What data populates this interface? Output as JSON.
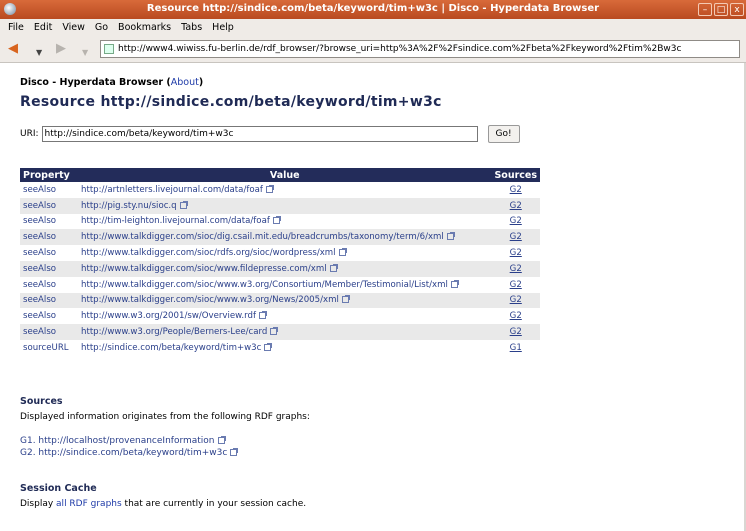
{
  "window": {
    "title": "Resource http://sindice.com/beta/keyword/tim+w3c | Disco - Hyperdata Browser",
    "buttons": [
      "–",
      "□",
      "x"
    ]
  },
  "menu": [
    "File",
    "Edit",
    "View",
    "Go",
    "Bookmarks",
    "Tabs",
    "Help"
  ],
  "nav": {
    "url": "http://www4.wiwiss.fu-berlin.de/rdf_browser/?browse_uri=http%3A%2F%2Fsindice.com%2Fbeta%2Fkeyword%2Ftim%2Bw3c"
  },
  "page": {
    "app_name": "Disco - Hyperdata Browser",
    "about_link": "About",
    "title": "Resource http://sindice.com/beta/keyword/tim+w3c",
    "uri_label": "URI:",
    "uri_value": "http://sindice.com/beta/keyword/tim+w3c",
    "go_label": "Go!",
    "table": {
      "headers": [
        "Property",
        "Value",
        "Sources"
      ],
      "rows": [
        {
          "property": "seeAlso",
          "value": "http://artnletters.livejournal.com/data/foaf",
          "source": "G2"
        },
        {
          "property": "seeAlso",
          "value": "http://pig.sty.nu/sioc.q",
          "source": "G2"
        },
        {
          "property": "seeAlso",
          "value": "http://tim-leighton.livejournal.com/data/foaf",
          "source": "G2"
        },
        {
          "property": "seeAlso",
          "value": "http://www.talkdigger.com/sioc/dig.csail.mit.edu/breadcrumbs/taxonomy/term/6/xml",
          "source": "G2"
        },
        {
          "property": "seeAlso",
          "value": "http://www.talkdigger.com/sioc/rdfs.org/sioc/wordpress/xml",
          "source": "G2"
        },
        {
          "property": "seeAlso",
          "value": "http://www.talkdigger.com/sioc/www.fildepresse.com/xml",
          "source": "G2"
        },
        {
          "property": "seeAlso",
          "value": "http://www.talkdigger.com/sioc/www.w3.org/Consortium/Member/Testimonial/List/xml",
          "source": "G2"
        },
        {
          "property": "seeAlso",
          "value": "http://www.talkdigger.com/sioc/www.w3.org/News/2005/xml",
          "source": "G2"
        },
        {
          "property": "seeAlso",
          "value": "http://www.w3.org/2001/sw/Overview.rdf",
          "source": "G2"
        },
        {
          "property": "seeAlso",
          "value": "http://www.w3.org/People/Berners-Lee/card",
          "source": "G2"
        },
        {
          "property": "sourceURL",
          "value": "http://sindice.com/beta/keyword/tim+w3c",
          "source": "G1"
        }
      ]
    },
    "sources": {
      "heading": "Sources",
      "text": "Displayed information originates from the following RDF graphs:",
      "graphs": [
        "G1. http://localhost/provenanceInformation",
        "G2. http://sindice.com/beta/keyword/tim+w3c"
      ]
    },
    "session": {
      "heading": "Session Cache",
      "text_before": "Display ",
      "link": "all RDF graphs",
      "text_after": " that are currently in your session cache."
    }
  },
  "colors": {
    "titlebar": "#c85a2c",
    "table_header": "#232c5a",
    "link": "#2a3f8a"
  }
}
